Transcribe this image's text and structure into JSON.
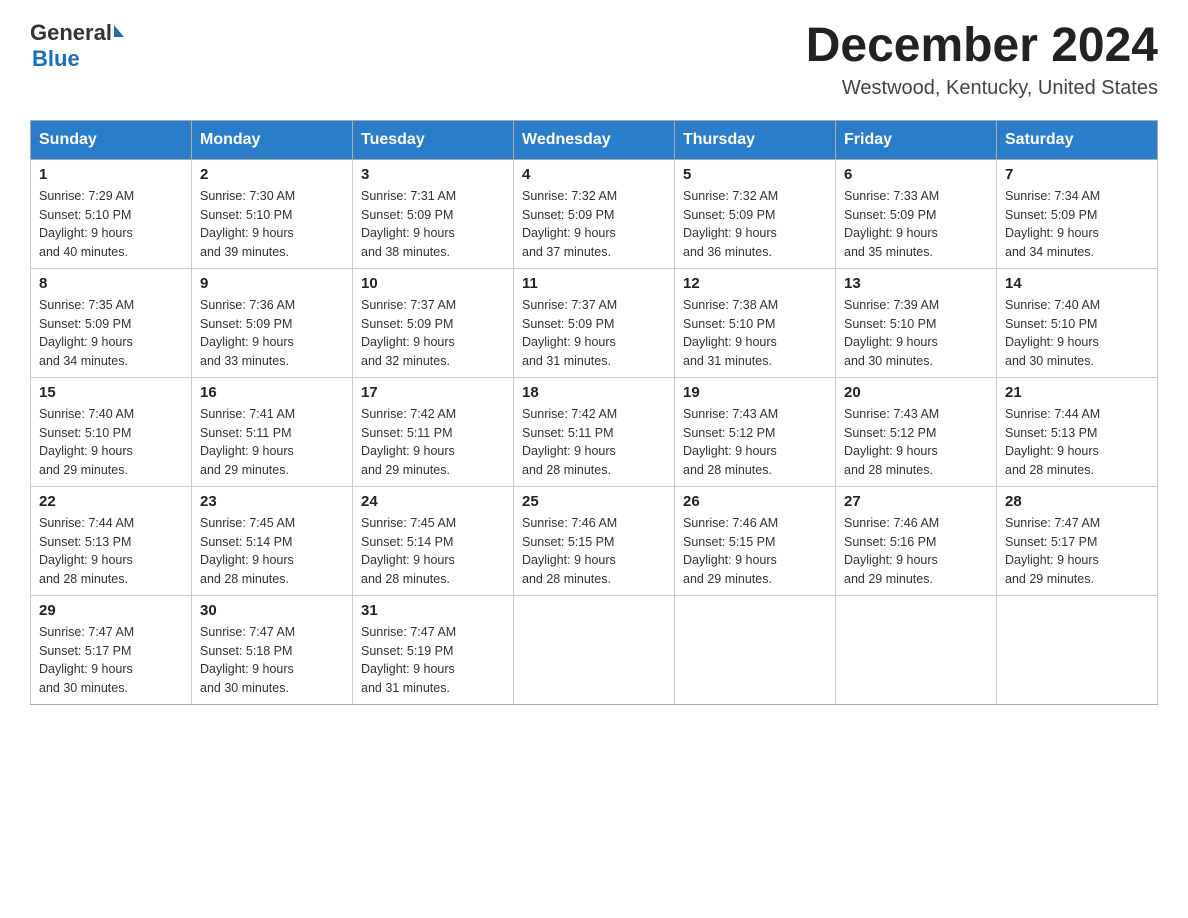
{
  "header": {
    "logo_general": "General",
    "logo_blue": "Blue",
    "month_title": "December 2024",
    "location": "Westwood, Kentucky, United States"
  },
  "weekdays": [
    "Sunday",
    "Monday",
    "Tuesday",
    "Wednesday",
    "Thursday",
    "Friday",
    "Saturday"
  ],
  "weeks": [
    [
      {
        "day": "1",
        "sunrise": "7:29 AM",
        "sunset": "5:10 PM",
        "daylight": "9 hours and 40 minutes."
      },
      {
        "day": "2",
        "sunrise": "7:30 AM",
        "sunset": "5:10 PM",
        "daylight": "9 hours and 39 minutes."
      },
      {
        "day": "3",
        "sunrise": "7:31 AM",
        "sunset": "5:09 PM",
        "daylight": "9 hours and 38 minutes."
      },
      {
        "day": "4",
        "sunrise": "7:32 AM",
        "sunset": "5:09 PM",
        "daylight": "9 hours and 37 minutes."
      },
      {
        "day": "5",
        "sunrise": "7:32 AM",
        "sunset": "5:09 PM",
        "daylight": "9 hours and 36 minutes."
      },
      {
        "day": "6",
        "sunrise": "7:33 AM",
        "sunset": "5:09 PM",
        "daylight": "9 hours and 35 minutes."
      },
      {
        "day": "7",
        "sunrise": "7:34 AM",
        "sunset": "5:09 PM",
        "daylight": "9 hours and 34 minutes."
      }
    ],
    [
      {
        "day": "8",
        "sunrise": "7:35 AM",
        "sunset": "5:09 PM",
        "daylight": "9 hours and 34 minutes."
      },
      {
        "day": "9",
        "sunrise": "7:36 AM",
        "sunset": "5:09 PM",
        "daylight": "9 hours and 33 minutes."
      },
      {
        "day": "10",
        "sunrise": "7:37 AM",
        "sunset": "5:09 PM",
        "daylight": "9 hours and 32 minutes."
      },
      {
        "day": "11",
        "sunrise": "7:37 AM",
        "sunset": "5:09 PM",
        "daylight": "9 hours and 31 minutes."
      },
      {
        "day": "12",
        "sunrise": "7:38 AM",
        "sunset": "5:10 PM",
        "daylight": "9 hours and 31 minutes."
      },
      {
        "day": "13",
        "sunrise": "7:39 AM",
        "sunset": "5:10 PM",
        "daylight": "9 hours and 30 minutes."
      },
      {
        "day": "14",
        "sunrise": "7:40 AM",
        "sunset": "5:10 PM",
        "daylight": "9 hours and 30 minutes."
      }
    ],
    [
      {
        "day": "15",
        "sunrise": "7:40 AM",
        "sunset": "5:10 PM",
        "daylight": "9 hours and 29 minutes."
      },
      {
        "day": "16",
        "sunrise": "7:41 AM",
        "sunset": "5:11 PM",
        "daylight": "9 hours and 29 minutes."
      },
      {
        "day": "17",
        "sunrise": "7:42 AM",
        "sunset": "5:11 PM",
        "daylight": "9 hours and 29 minutes."
      },
      {
        "day": "18",
        "sunrise": "7:42 AM",
        "sunset": "5:11 PM",
        "daylight": "9 hours and 28 minutes."
      },
      {
        "day": "19",
        "sunrise": "7:43 AM",
        "sunset": "5:12 PM",
        "daylight": "9 hours and 28 minutes."
      },
      {
        "day": "20",
        "sunrise": "7:43 AM",
        "sunset": "5:12 PM",
        "daylight": "9 hours and 28 minutes."
      },
      {
        "day": "21",
        "sunrise": "7:44 AM",
        "sunset": "5:13 PM",
        "daylight": "9 hours and 28 minutes."
      }
    ],
    [
      {
        "day": "22",
        "sunrise": "7:44 AM",
        "sunset": "5:13 PM",
        "daylight": "9 hours and 28 minutes."
      },
      {
        "day": "23",
        "sunrise": "7:45 AM",
        "sunset": "5:14 PM",
        "daylight": "9 hours and 28 minutes."
      },
      {
        "day": "24",
        "sunrise": "7:45 AM",
        "sunset": "5:14 PM",
        "daylight": "9 hours and 28 minutes."
      },
      {
        "day": "25",
        "sunrise": "7:46 AM",
        "sunset": "5:15 PM",
        "daylight": "9 hours and 28 minutes."
      },
      {
        "day": "26",
        "sunrise": "7:46 AM",
        "sunset": "5:15 PM",
        "daylight": "9 hours and 29 minutes."
      },
      {
        "day": "27",
        "sunrise": "7:46 AM",
        "sunset": "5:16 PM",
        "daylight": "9 hours and 29 minutes."
      },
      {
        "day": "28",
        "sunrise": "7:47 AM",
        "sunset": "5:17 PM",
        "daylight": "9 hours and 29 minutes."
      }
    ],
    [
      {
        "day": "29",
        "sunrise": "7:47 AM",
        "sunset": "5:17 PM",
        "daylight": "9 hours and 30 minutes."
      },
      {
        "day": "30",
        "sunrise": "7:47 AM",
        "sunset": "5:18 PM",
        "daylight": "9 hours and 30 minutes."
      },
      {
        "day": "31",
        "sunrise": "7:47 AM",
        "sunset": "5:19 PM",
        "daylight": "9 hours and 31 minutes."
      },
      null,
      null,
      null,
      null
    ]
  ]
}
